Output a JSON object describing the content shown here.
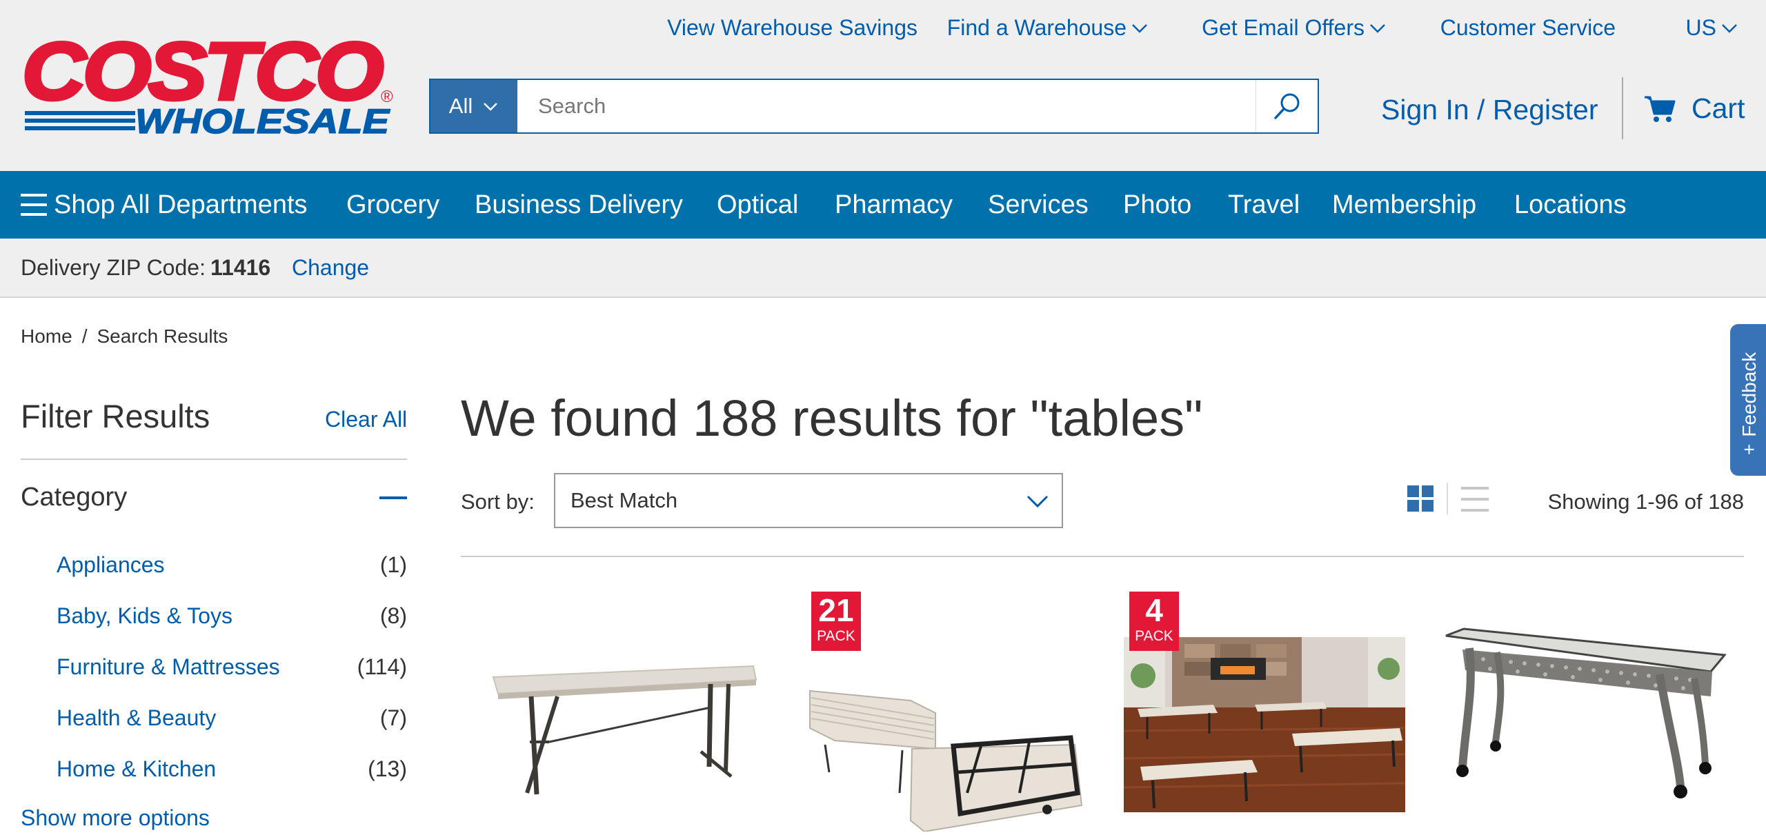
{
  "header": {
    "logo_top": "COSTCO",
    "logo_bottom": "WHOLESALE",
    "logo_reg": "®",
    "utility_links": {
      "savings": "View Warehouse Savings",
      "find_warehouse": "Find a Warehouse",
      "email_offers": "Get Email Offers",
      "customer_service": "Customer Service",
      "country": "US"
    },
    "search": {
      "category": "All",
      "placeholder": "Search"
    },
    "sign_in": "Sign In / Register",
    "cart": "Cart"
  },
  "nav": {
    "shop_all": "Shop All Departments",
    "grocery": "Grocery",
    "business_delivery": "Business Delivery",
    "optical": "Optical",
    "pharmacy": "Pharmacy",
    "services": "Services",
    "photo": "Photo",
    "travel": "Travel",
    "membership": "Membership",
    "locations": "Locations"
  },
  "zip": {
    "label": "Delivery ZIP Code:",
    "code": "11416",
    "change": "Change"
  },
  "breadcrumb": {
    "home": "Home",
    "sep": "/",
    "current": "Search Results"
  },
  "filter": {
    "title": "Filter Results",
    "clear_all": "Clear All",
    "category_title": "Category",
    "categories": [
      {
        "name": "Appliances",
        "count": "(1)"
      },
      {
        "name": "Baby, Kids & Toys",
        "count": "(8)"
      },
      {
        "name": "Furniture & Mattresses",
        "count": "(114)"
      },
      {
        "name": "Health & Beauty",
        "count": "(7)"
      },
      {
        "name": "Home & Kitchen",
        "count": "(13)"
      }
    ],
    "show_more": "Show more options"
  },
  "results": {
    "title": "We found 188 results for \"tables\"",
    "sort_label": "Sort by:",
    "sort_value": "Best Match",
    "showing": "Showing 1-96 of 188"
  },
  "products": [
    {
      "badge": null
    },
    {
      "badge": {
        "num": "21",
        "label": "PACK"
      }
    },
    {
      "badge": {
        "num": "4",
        "label": "PACK"
      }
    },
    {
      "badge": null
    }
  ],
  "feedback": {
    "label": "Feedback",
    "plus": "+"
  },
  "colors": {
    "brand_red": "#e31837",
    "brand_blue": "#005dab",
    "nav_blue": "#0071ab"
  }
}
